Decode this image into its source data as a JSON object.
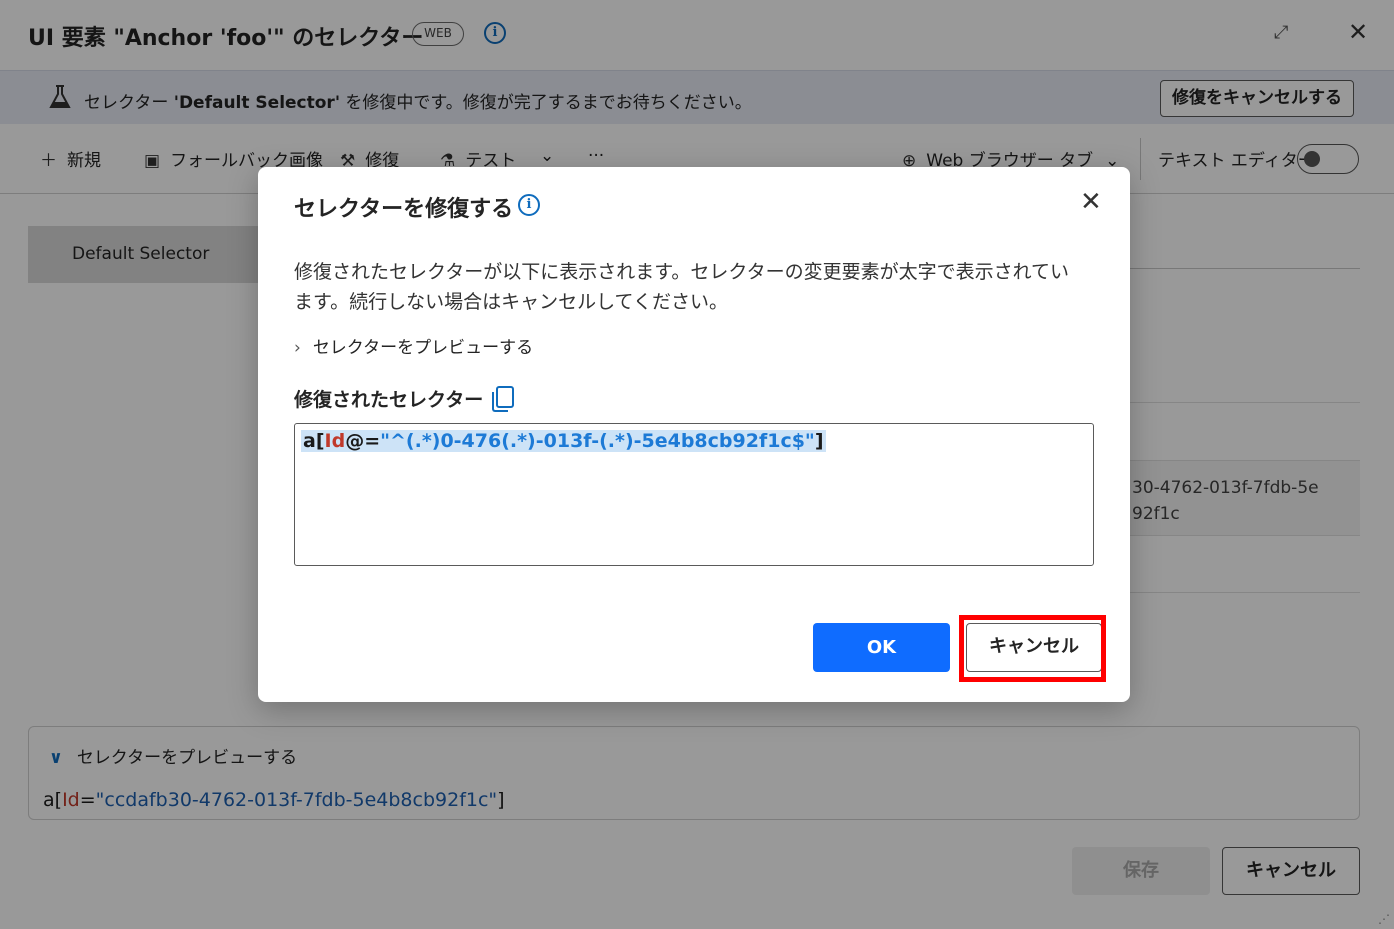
{
  "window": {
    "title": "UI 要素 \"Anchor 'foo'\" のセレクター",
    "badge": "WEB",
    "info_icon": "info-icon",
    "expand_icon": "↗↙",
    "close_icon": "✕"
  },
  "infobar": {
    "text_prefix": "セレクター ",
    "selector_name": "'Default Selector'",
    "text_suffix": " を修復中です。修復が完了するまでお待ちください。",
    "cancel_button": "修復をキャンセルする"
  },
  "toolbar": {
    "new": "新規",
    "fallback_image": "フォールバック画像",
    "repair": "修復",
    "test": "テスト",
    "more": "···",
    "browser_tab": "Web ブラウザー タブ",
    "text_editor": "テキスト エディター"
  },
  "selector_list": {
    "items": [
      "Default Selector"
    ]
  },
  "right_panel": {
    "text": "30-4762-013f-7fdb-5e\n92f1c"
  },
  "preview": {
    "header": "セレクターをプレビューする",
    "code_tag": "a[",
    "code_attr": "Id",
    "code_eq": "=",
    "code_value": "\"ccdafb30-4762-013f-7fdb-5e4b8cb92f1c\"",
    "code_end": "]"
  },
  "footer": {
    "save": "保存",
    "cancel": "キャンセル"
  },
  "modal": {
    "title": "セレクターを修復する",
    "description": "修復されたセレクターが以下に表示されます。セレクターの変更要素が太字で表示されています。続行しない場合はキャンセルしてください。",
    "preview_toggle": "セレクターをプレビューする",
    "field_label": "修復されたセレクター",
    "code_tag": "a[",
    "code_attr": "Id",
    "code_op": "@=",
    "code_value": "\"^(.*)0-476(.*)-013f-(.*)-5e4b8cb92f1c$\"",
    "code_end": "]",
    "ok": "OK",
    "cancel": "キャンセル"
  },
  "colors": {
    "accent": "#0f6cff",
    "highlight": "#ff0000",
    "attr": "#c0392b",
    "string": "#1d5fb0"
  }
}
